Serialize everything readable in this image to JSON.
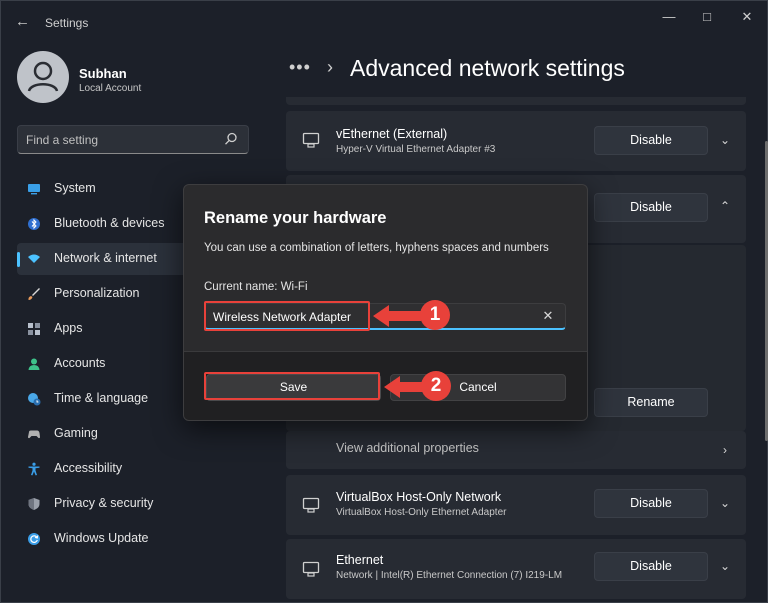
{
  "window": {
    "title": "Settings",
    "controls": [
      "minimize",
      "maximize",
      "close"
    ]
  },
  "user": {
    "name": "Subhan",
    "account_type": "Local Account"
  },
  "search": {
    "placeholder": "Find a setting"
  },
  "sidebar": {
    "active": "Network & internet",
    "items": [
      {
        "label": "System",
        "icon": "monitor-icon",
        "color": "#3aa0e8"
      },
      {
        "label": "Bluetooth & devices",
        "icon": "bluetooth-icon",
        "color": "#3a8ee8"
      },
      {
        "label": "Network & internet",
        "icon": "wifi-icon",
        "color": "#4cc2ff"
      },
      {
        "label": "Personalization",
        "icon": "brush-icon",
        "color": "#e89a5a"
      },
      {
        "label": "Apps",
        "icon": "apps-icon",
        "color": "#a0a8b8"
      },
      {
        "label": "Accounts",
        "icon": "person-icon",
        "color": "#3ec28a"
      },
      {
        "label": "Time & language",
        "icon": "globe-clock-icon",
        "color": "#4aa8e8"
      },
      {
        "label": "Gaming",
        "icon": "gamepad-icon",
        "color": "#b0b0b0"
      },
      {
        "label": "Accessibility",
        "icon": "accessibility-icon",
        "color": "#3a9ee8"
      },
      {
        "label": "Privacy & security",
        "icon": "shield-icon",
        "color": "#9aa0aa"
      },
      {
        "label": "Windows Update",
        "icon": "update-icon",
        "color": "#3a9ee8"
      }
    ]
  },
  "main": {
    "breadcrumb_more": "•••",
    "title": "Advanced network settings",
    "adapters": [
      {
        "name": "vEthernet (External)",
        "description": "Hyper-V Virtual Ethernet Adapter #3",
        "button": "Disable",
        "expanded": false
      },
      {
        "name": "",
        "description": "",
        "button": "Disable",
        "expanded": true
      },
      {
        "name": "VirtualBox Host-Only Network",
        "description": "VirtualBox Host-Only Ethernet Adapter",
        "button": "Disable",
        "expanded": false
      },
      {
        "name": "Ethernet",
        "description": "Network | Intel(R) Ethernet Connection (7) I219-LM",
        "button": "Disable",
        "expanded": false
      }
    ],
    "rename_button": "Rename",
    "view_properties": "View additional properties"
  },
  "dialog": {
    "title": "Rename your hardware",
    "description": "You can use a combination of letters, hyphens spaces and numbers",
    "current_name_label": "Current name: Wi-Fi",
    "input_value": "Wireless Network Adapter",
    "save_label": "Save",
    "cancel_label": "Cancel"
  },
  "callouts": [
    {
      "number": "1",
      "target": "name-input"
    },
    {
      "number": "2",
      "target": "save-button"
    }
  ],
  "colors": {
    "accent": "#4cc2ff",
    "callout_red": "#e8413a"
  }
}
